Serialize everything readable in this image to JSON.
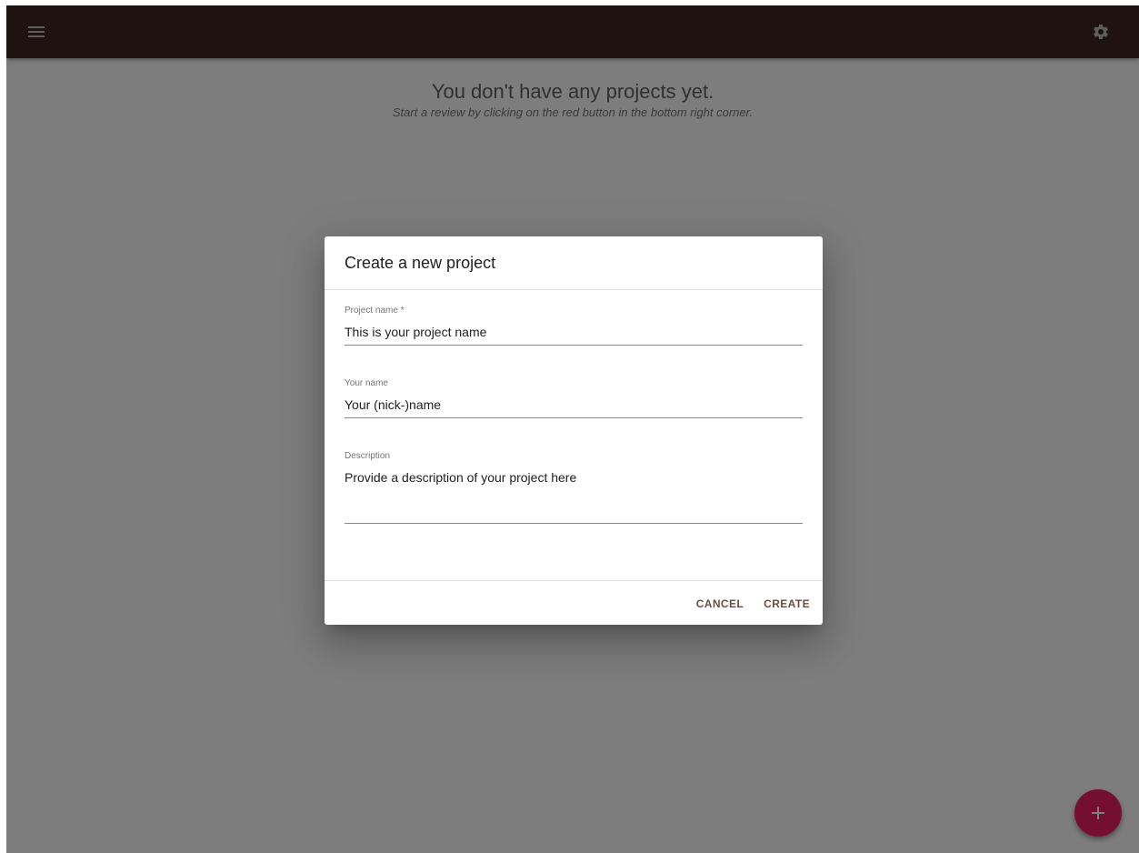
{
  "app": {
    "menu_icon": "menu-icon",
    "settings_icon": "gear-icon",
    "fab_icon": "plus-icon",
    "colors": {
      "appbar": "#3e2723",
      "fab": "#e91e63",
      "action_text": "#6d4c41"
    }
  },
  "empty_state": {
    "title": "You don't have any projects yet.",
    "subtitle": "Start a review by clicking on the red button in the bottom right corner."
  },
  "dialog": {
    "title": "Create a new project",
    "fields": {
      "project_name": {
        "label": "Project name *",
        "placeholder": "This is your project name"
      },
      "your_name": {
        "label": "Your name",
        "placeholder": "Your (nick-)name"
      },
      "description": {
        "label": "Description",
        "placeholder": "Provide a description of your project here"
      }
    },
    "actions": {
      "cancel": "CANCEL",
      "create": "CREATE"
    }
  }
}
